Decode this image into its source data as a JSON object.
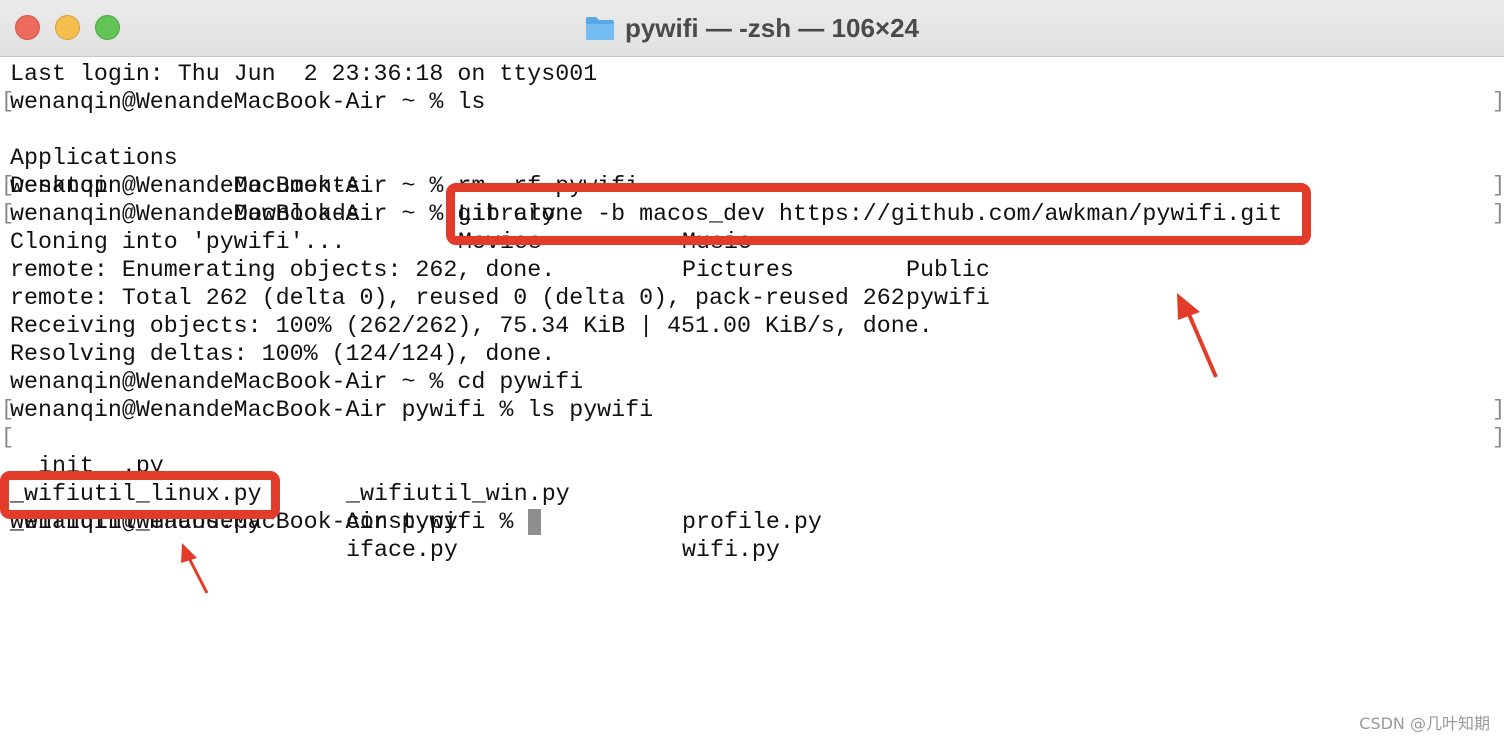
{
  "window": {
    "title": "pywifi — -zsh — 106×24"
  },
  "terminal": {
    "lines": [
      "Last login: Thu Jun  2 23:36:18 on ttys001",
      "wenanqin@WenandeMacBook-Air ~ % ls",
      "",
      "",
      "wenanqin@WenandeMacBook-Air ~ % rm -rf pywifi",
      "wenanqin@WenandeMacBook-Air ~ % git clone -b macos_dev https://github.com/awkman/pywifi.git",
      "Cloning into 'pywifi'...",
      "remote: Enumerating objects: 262, done.",
      "remote: Total 262 (delta 0), reused 0 (delta 0), pack-reused 262",
      "Receiving objects: 100% (262/262), 75.34 KiB | 451.00 KiB/s, done.",
      "Resolving deltas: 100% (124/124), done.",
      "wenanqin@WenandeMacBook-Air ~ % cd pywifi",
      "wenanqin@WenandeMacBook-Air pywifi % ls pywifi",
      "",
      "",
      "",
      "wenanqin@WenandeMacBook-Air pywifi % "
    ],
    "ls_home": {
      "row1": [
        "Applications",
        "Documents",
        "Library",
        "Music",
        "Public"
      ],
      "row2": [
        "Desktop",
        "Downloads",
        "Movies",
        "Pictures",
        "pywifi"
      ]
    },
    "ls_pywifi": {
      "row1": [
        "__init__.py",
        "_wifiutil_win.py",
        "profile.py"
      ],
      "row2": [
        "_wifiutil_linux.py",
        "const.py",
        "wifi.py"
      ],
      "row3": [
        "_wifiutil_macos.py",
        "iface.py"
      ]
    },
    "bracket_left": "[",
    "bracket_right": "]"
  },
  "watermark": "CSDN @几叶知期",
  "colors": {
    "annotation_red": "#e23b2a",
    "cursor": "#8e8e8e"
  },
  "icons": {
    "title_icon": "folder-icon"
  }
}
